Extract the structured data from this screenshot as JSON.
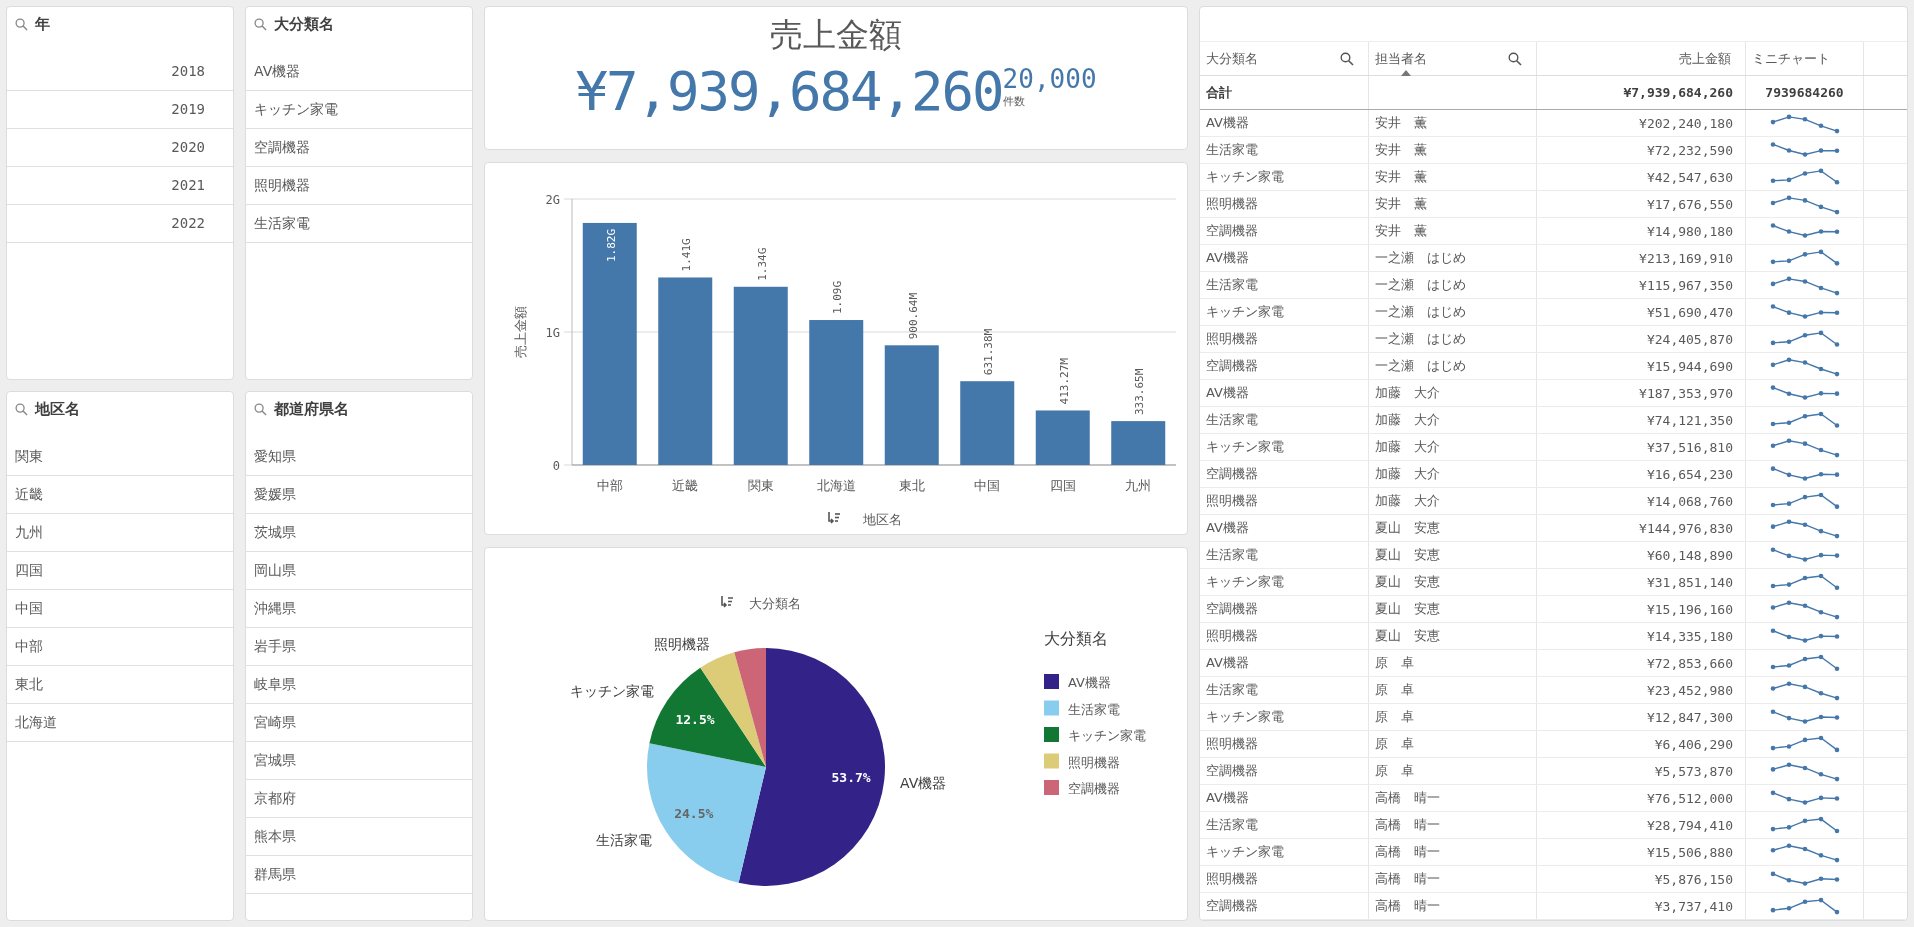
{
  "filters": [
    {
      "title": "年",
      "kind": "number",
      "items": [
        "2018",
        "2019",
        "2020",
        "2021",
        "2022"
      ]
    },
    {
      "title": "大分類名",
      "kind": "text",
      "items": [
        "AV機器",
        "キッチン家電",
        "空調機器",
        "照明機器",
        "生活家電"
      ]
    },
    {
      "title": "地区名",
      "kind": "text",
      "items": [
        "関東",
        "近畿",
        "九州",
        "四国",
        "中国",
        "中部",
        "東北",
        "北海道"
      ]
    },
    {
      "title": "都道府県名",
      "kind": "text",
      "items": [
        "愛知県",
        "愛媛県",
        "茨城県",
        "岡山県",
        "沖縄県",
        "岩手県",
        "岐阜県",
        "宮崎県",
        "宮城県",
        "京都府",
        "熊本県",
        "群馬県"
      ]
    }
  ],
  "kpi": {
    "title": "売上金額",
    "value": "¥7,939,684,260",
    "secondary_value": "20,000",
    "secondary_label": "件数"
  },
  "bar_chart": {
    "chart_data": {
      "type": "bar",
      "xlabel": "地区名",
      "ylabel": "売上金額",
      "categories": [
        "中部",
        "近畿",
        "関東",
        "北海道",
        "東北",
        "中国",
        "四国",
        "九州"
      ],
      "series": [
        {
          "color": "#4477aa",
          "values": [
            1.82,
            1.41,
            1.34,
            1.09,
            0.9,
            0.63,
            0.41,
            0.33
          ]
        }
      ],
      "ylim": [
        0,
        2
      ],
      "yticks": [
        {
          "value": 0,
          "label": "0"
        },
        {
          "value": 1,
          "label": "1G"
        },
        {
          "value": 2,
          "label": "2G"
        }
      ],
      "value_labels": [
        "1.82G",
        "1.41G",
        "1.34G",
        "1.09G",
        "900.64M",
        "631.38M",
        "413.27M",
        "333.65M"
      ]
    }
  },
  "pie_chart": {
    "sort_label": "大分類名",
    "outer_labels": [
      true,
      true,
      true,
      true,
      false
    ],
    "chart_data": {
      "type": "pie",
      "categories": [
        "AV機器",
        "生活家電",
        "キッチン家電",
        "照明機器",
        "空調機器"
      ],
      "values": [
        53.7,
        24.5,
        12.5,
        5.0,
        4.3
      ],
      "value_labels": [
        "53.7%",
        "24.5%",
        "12.5%",
        null,
        null
      ],
      "colors": [
        "#332288",
        "#88ccee",
        "#117733",
        "#ddcc77",
        "#cc6677"
      ],
      "legend": {
        "title": "大分類名"
      }
    }
  },
  "table": {
    "columns": [
      {
        "label": "大分類名",
        "searchable": true,
        "sorted": false,
        "kind": "text"
      },
      {
        "label": "担当者名",
        "searchable": true,
        "sorted": true,
        "kind": "text"
      },
      {
        "label": "売上金額",
        "searchable": false,
        "sorted": false,
        "kind": "amount"
      },
      {
        "label": "ミニチャート",
        "searchable": false,
        "sorted": false,
        "kind": "chart"
      }
    ],
    "total": {
      "label": "合計",
      "amount": "¥7,939,684,260",
      "mini_chart": "7939684260"
    },
    "rows": [
      {
        "category": "AV機器",
        "person": "安井　薫",
        "amount": "¥202,240,180"
      },
      {
        "category": "生活家電",
        "person": "安井　薫",
        "amount": "¥72,232,590"
      },
      {
        "category": "キッチン家電",
        "person": "安井　薫",
        "amount": "¥42,547,630"
      },
      {
        "category": "照明機器",
        "person": "安井　薫",
        "amount": "¥17,676,550"
      },
      {
        "category": "空調機器",
        "person": "安井　薫",
        "amount": "¥14,980,180"
      },
      {
        "category": "AV機器",
        "person": "一之瀬　はじめ",
        "amount": "¥213,169,910"
      },
      {
        "category": "生活家電",
        "person": "一之瀬　はじめ",
        "amount": "¥115,967,350"
      },
      {
        "category": "キッチン家電",
        "person": "一之瀬　はじめ",
        "amount": "¥51,690,470"
      },
      {
        "category": "照明機器",
        "person": "一之瀬　はじめ",
        "amount": "¥24,405,870"
      },
      {
        "category": "空調機器",
        "person": "一之瀬　はじめ",
        "amount": "¥15,944,690"
      },
      {
        "category": "AV機器",
        "person": "加藤　大介",
        "amount": "¥187,353,970"
      },
      {
        "category": "生活家電",
        "person": "加藤　大介",
        "amount": "¥74,121,350"
      },
      {
        "category": "キッチン家電",
        "person": "加藤　大介",
        "amount": "¥37,516,810"
      },
      {
        "category": "空調機器",
        "person": "加藤　大介",
        "amount": "¥16,654,230"
      },
      {
        "category": "照明機器",
        "person": "加藤　大介",
        "amount": "¥14,068,760"
      },
      {
        "category": "AV機器",
        "person": "夏山　安恵",
        "amount": "¥144,976,830"
      },
      {
        "category": "生活家電",
        "person": "夏山　安恵",
        "amount": "¥60,148,890"
      },
      {
        "category": "キッチン家電",
        "person": "夏山　安恵",
        "amount": "¥31,851,140"
      },
      {
        "category": "空調機器",
        "person": "夏山　安恵",
        "amount": "¥15,196,160"
      },
      {
        "category": "照明機器",
        "person": "夏山　安恵",
        "amount": "¥14,335,180"
      },
      {
        "category": "AV機器",
        "person": "原　卓",
        "amount": "¥72,853,660"
      },
      {
        "category": "生活家電",
        "person": "原　卓",
        "amount": "¥23,452,980"
      },
      {
        "category": "キッチン家電",
        "person": "原　卓",
        "amount": "¥12,847,300"
      },
      {
        "category": "照明機器",
        "person": "原　卓",
        "amount": "¥6,406,290"
      },
      {
        "category": "空調機器",
        "person": "原　卓",
        "amount": "¥5,573,870"
      },
      {
        "category": "AV機器",
        "person": "高橋　晴一",
        "amount": "¥76,512,000"
      },
      {
        "category": "生活家電",
        "person": "高橋　晴一",
        "amount": "¥28,794,410"
      },
      {
        "category": "キッチン家電",
        "person": "高橋　晴一",
        "amount": "¥15,506,880"
      },
      {
        "category": "照明機器",
        "person": "高橋　晴一",
        "amount": "¥5,876,150"
      },
      {
        "category": "空調機器",
        "person": "高橋　晴一",
        "amount": "¥3,737,410"
      }
    ]
  }
}
